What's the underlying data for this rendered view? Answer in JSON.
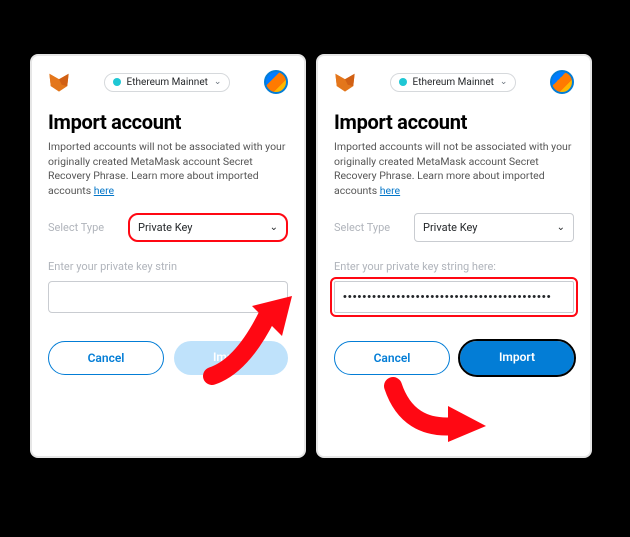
{
  "network": {
    "name": "Ethereum Mainnet"
  },
  "page": {
    "title": "Import account",
    "description": "Imported accounts will not be associated with your originally created MetaMask account Secret Recovery Phrase. Learn more about imported accounts ",
    "link_text": "here"
  },
  "select": {
    "label": "Select Type",
    "value": "Private Key"
  },
  "field": {
    "label_short": "Enter your private key strin",
    "label_full": "Enter your private key string here:",
    "filled_mask": "•••••••••••••••••••••••••••••••••••••••••••"
  },
  "buttons": {
    "cancel": "Cancel",
    "import": "Import"
  }
}
